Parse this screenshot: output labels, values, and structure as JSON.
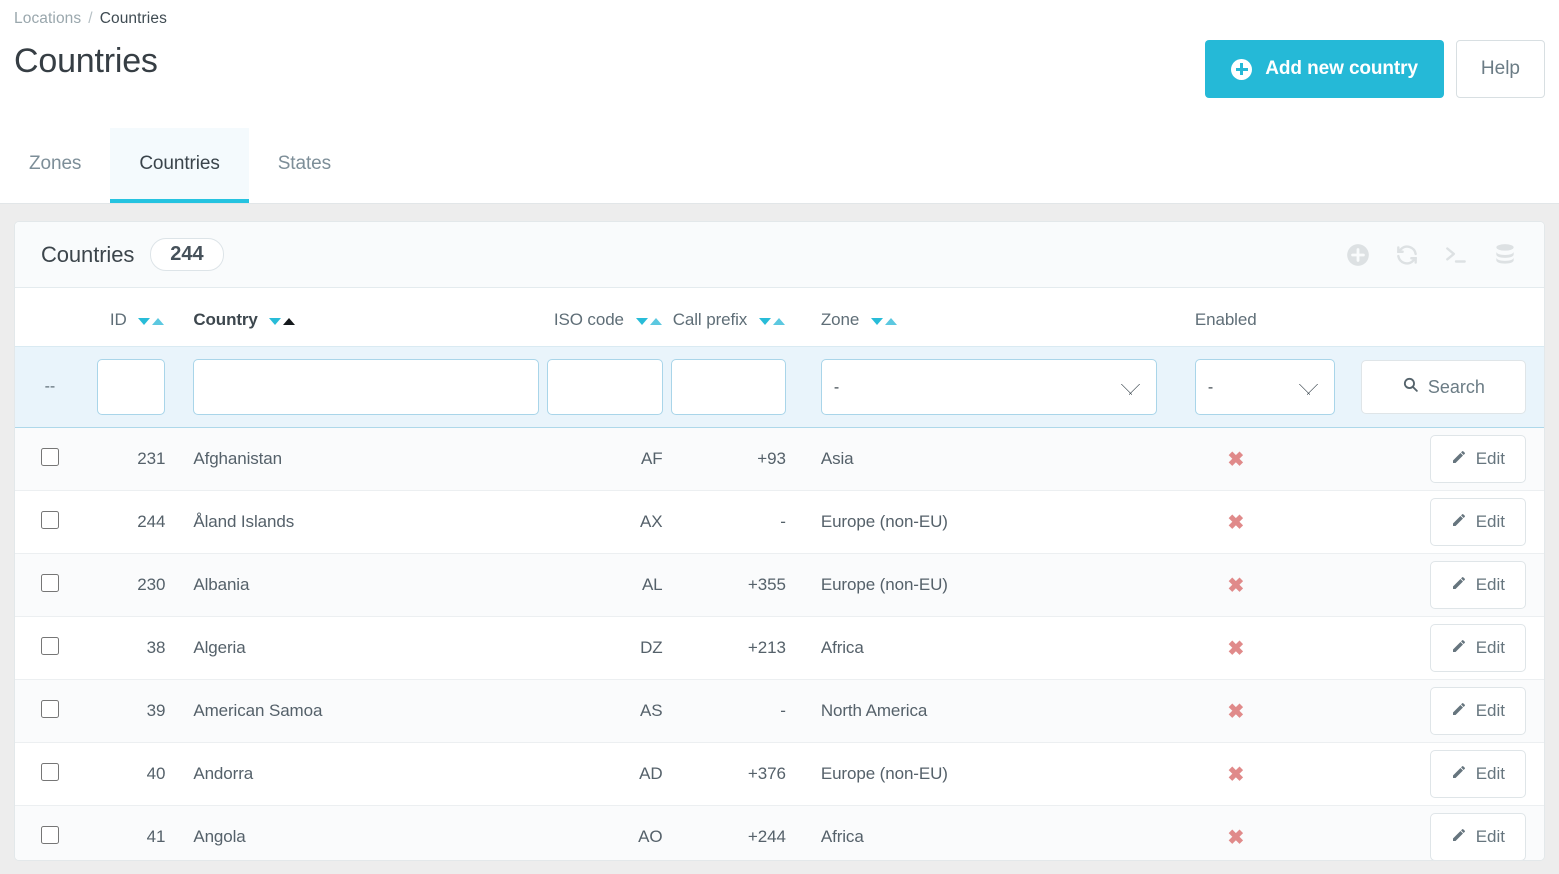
{
  "breadcrumb": {
    "parent": "Locations",
    "separator": "/",
    "current": "Countries"
  },
  "page": {
    "title": "Countries"
  },
  "header_actions": {
    "add_label": "Add new country",
    "help_label": "Help",
    "add_icon": "plus-circle-icon",
    "accent_color": "#25b9d7"
  },
  "tabs": [
    {
      "label": "Zones",
      "active": false
    },
    {
      "label": "Countries",
      "active": true
    },
    {
      "label": "States",
      "active": false
    }
  ],
  "panel": {
    "title": "Countries",
    "count": "244",
    "tools": [
      "plus-circle-icon",
      "refresh-icon",
      "console-icon",
      "database-icon"
    ]
  },
  "table": {
    "columns": [
      {
        "key": "checkbox",
        "label": "",
        "sortable": false
      },
      {
        "key": "id",
        "label": "ID",
        "sortable": true,
        "sorted": false
      },
      {
        "key": "country",
        "label": "Country",
        "sortable": true,
        "sorted": true,
        "direction": "asc"
      },
      {
        "key": "iso",
        "label": "ISO code",
        "sortable": true,
        "sorted": false
      },
      {
        "key": "prefix",
        "label": "Call prefix",
        "sortable": true,
        "sorted": false
      },
      {
        "key": "zone",
        "label": "Zone",
        "sortable": true,
        "sorted": false
      },
      {
        "key": "enabled",
        "label": "Enabled",
        "sortable": false
      },
      {
        "key": "actions",
        "label": "",
        "sortable": false
      }
    ],
    "filters": {
      "bulk_placeholder_text": "--",
      "id_value": "",
      "country_value": "",
      "iso_value": "",
      "prefix_value": "",
      "zone_selected": "-",
      "enabled_selected": "-",
      "search_label": "Search",
      "search_icon": "search-icon"
    },
    "row_action_label": "Edit",
    "row_action_icon": "pencil-icon",
    "enabled_false_icon": "x-mark",
    "enabled_false_color": "#e08a8a",
    "rows": [
      {
        "id": "231",
        "country": "Afghanistan",
        "iso": "AF",
        "prefix": "+93",
        "zone": "Asia",
        "enabled": "✖"
      },
      {
        "id": "244",
        "country": "Åland Islands",
        "iso": "AX",
        "prefix": "-",
        "zone": "Europe (non-EU)",
        "enabled": "✖"
      },
      {
        "id": "230",
        "country": "Albania",
        "iso": "AL",
        "prefix": "+355",
        "zone": "Europe (non-EU)",
        "enabled": "✖"
      },
      {
        "id": "38",
        "country": "Algeria",
        "iso": "DZ",
        "prefix": "+213",
        "zone": "Africa",
        "enabled": "✖"
      },
      {
        "id": "39",
        "country": "American Samoa",
        "iso": "AS",
        "prefix": "-",
        "zone": "North America",
        "enabled": "✖"
      },
      {
        "id": "40",
        "country": "Andorra",
        "iso": "AD",
        "prefix": "+376",
        "zone": "Europe (non-EU)",
        "enabled": "✖"
      },
      {
        "id": "41",
        "country": "Angola",
        "iso": "AO",
        "prefix": "+244",
        "zone": "Africa",
        "enabled": "✖"
      }
    ]
  }
}
